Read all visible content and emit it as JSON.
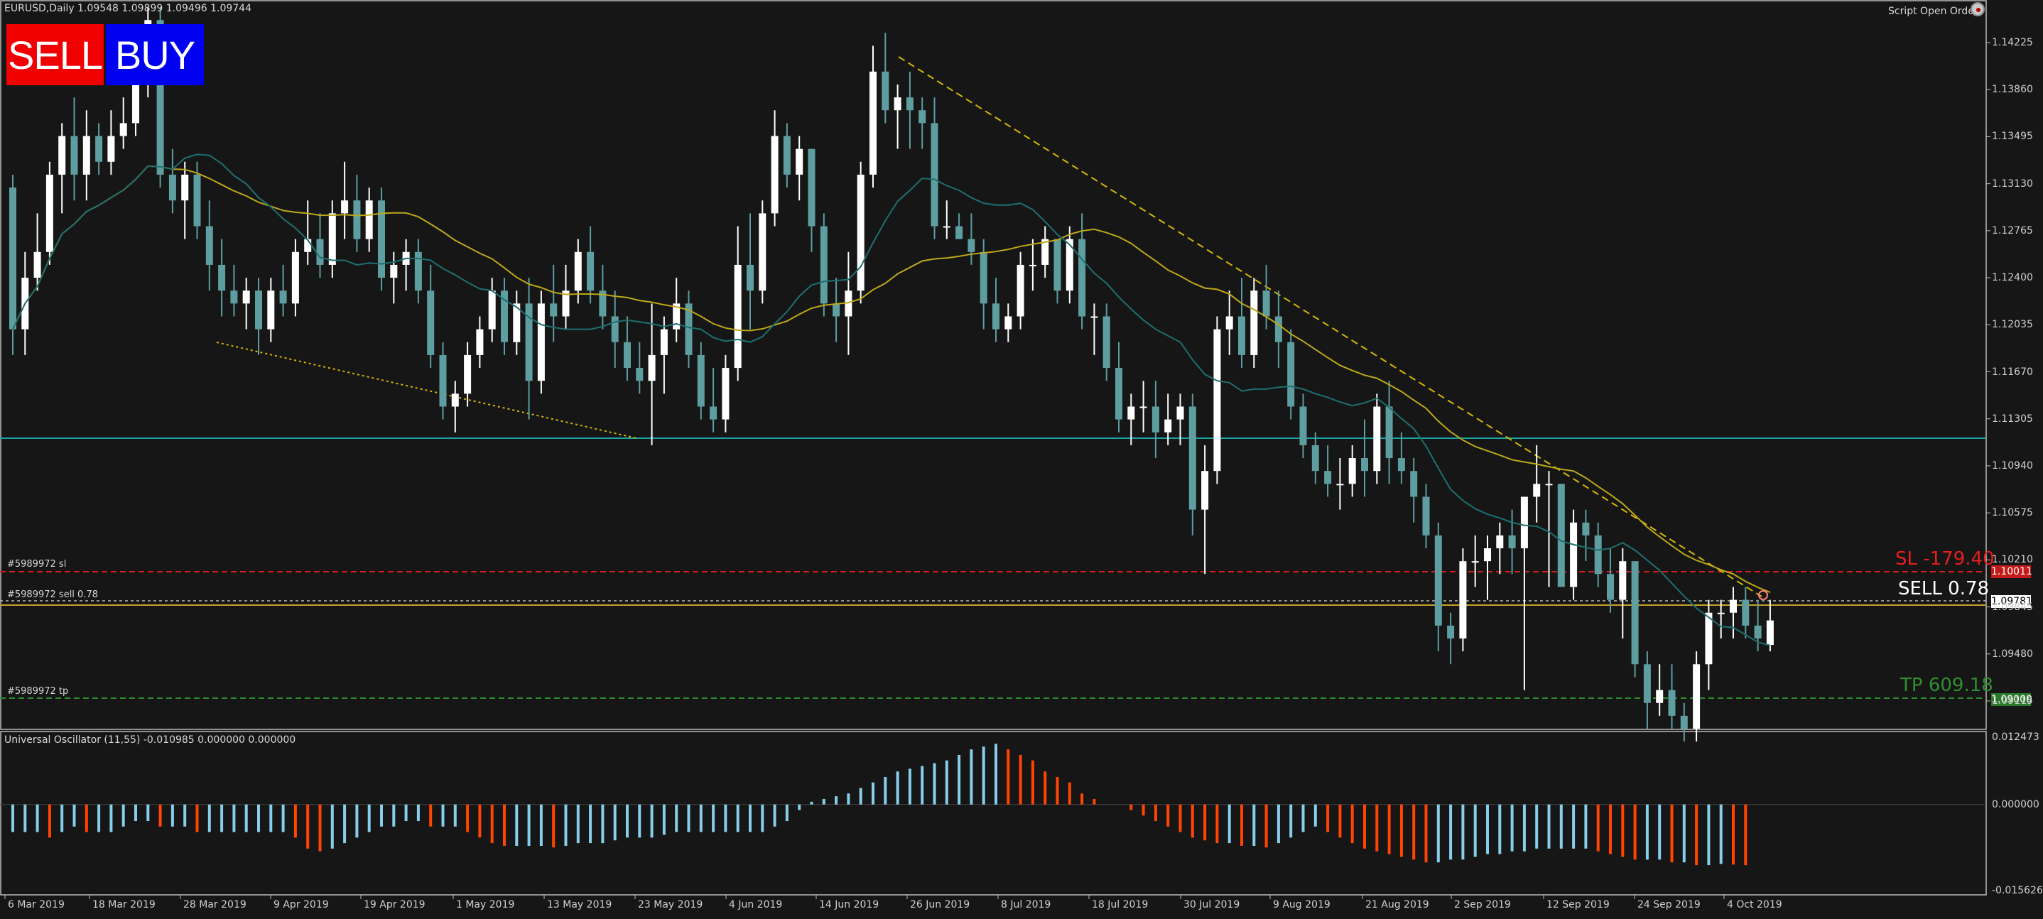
{
  "header": {
    "symbol_info": "EURUSD,Daily  1.09548 1.09899 1.09496 1.09744",
    "script_label": "Script Open Order"
  },
  "buttons": {
    "sell": "SELL",
    "buy": "BUY"
  },
  "trade_lines": {
    "sl_tag": "#5989972 sl",
    "sell_tag": "#5989972 sell 0.78",
    "tp_tag": "#5989972 tp",
    "sl_text": "SL  -179.40",
    "sell_text": "SELL  0.78",
    "tp_text": "TP  609.18",
    "sl_price": "1.10011",
    "sell_price": "1.09781",
    "tp_price": "1.09000"
  },
  "oscillator": {
    "label": "Universal Oscillator (11,55) -0.010985 0.000000 0.000000",
    "y_ticks": [
      "0.012473",
      "0.000000",
      "-0.015626"
    ]
  },
  "price_axis": [
    "1.14225",
    "1.13860",
    "1.13495",
    "1.13130",
    "1.12765",
    "1.12400",
    "1.12035",
    "1.11670",
    "1.11305",
    "1.10940",
    "1.10575",
    "1.10210",
    "1.09845",
    "1.09480",
    "1.09115"
  ],
  "time_axis": [
    "6 Mar 2019",
    "18 Mar 2019",
    "28 Mar 2019",
    "9 Apr 2019",
    "19 Apr 2019",
    "1 May 2019",
    "13 May 2019",
    "23 May 2019",
    "4 Jun 2019",
    "14 Jun 2019",
    "26 Jun 2019",
    "8 Jul 2019",
    "18 Jul 2019",
    "30 Jul 2019",
    "9 Aug 2019",
    "21 Aug 2019",
    "2 Sep 2019",
    "12 Sep 2019",
    "24 Sep 2019",
    "4 Oct 2019"
  ],
  "colors": {
    "background": "#161616",
    "bull_candle": "#ffffff",
    "bear_candle": "#5f9ea0",
    "sl_line": "#d11f1f",
    "tp_line": "#2d8c2d",
    "level_line": "#18a6a6",
    "osc_bull": "#87ceeb",
    "osc_bear": "#ff4500",
    "trend_line": "#d4b800"
  },
  "icons": {
    "script_icon": "script-running-icon"
  },
  "chart_data": {
    "type": "candlestick",
    "title": "EURUSD,Daily",
    "candles": [
      [
        1.131,
        1.132,
        1.118,
        1.12
      ],
      [
        1.12,
        1.126,
        1.118,
        1.124
      ],
      [
        1.124,
        1.129,
        1.123,
        1.126
      ],
      [
        1.126,
        1.133,
        1.125,
        1.132
      ],
      [
        1.132,
        1.136,
        1.129,
        1.135
      ],
      [
        1.135,
        1.138,
        1.13,
        1.132
      ],
      [
        1.132,
        1.137,
        1.13,
        1.135
      ],
      [
        1.135,
        1.136,
        1.132,
        1.133
      ],
      [
        1.133,
        1.137,
        1.132,
        1.135
      ],
      [
        1.135,
        1.138,
        1.134,
        1.136
      ],
      [
        1.136,
        1.141,
        1.135,
        1.14
      ],
      [
        1.14,
        1.145,
        1.138,
        1.144
      ],
      [
        1.144,
        1.145,
        1.131,
        1.132
      ],
      [
        1.132,
        1.134,
        1.129,
        1.13
      ],
      [
        1.13,
        1.133,
        1.127,
        1.132
      ],
      [
        1.132,
        1.133,
        1.127,
        1.128
      ],
      [
        1.128,
        1.13,
        1.123,
        1.125
      ],
      [
        1.125,
        1.127,
        1.121,
        1.123
      ],
      [
        1.123,
        1.125,
        1.121,
        1.122
      ],
      [
        1.122,
        1.124,
        1.12,
        1.123
      ],
      [
        1.123,
        1.124,
        1.118,
        1.12
      ],
      [
        1.12,
        1.124,
        1.119,
        1.123
      ],
      [
        1.123,
        1.125,
        1.121,
        1.122
      ],
      [
        1.122,
        1.127,
        1.121,
        1.126
      ],
      [
        1.126,
        1.13,
        1.125,
        1.127
      ],
      [
        1.127,
        1.129,
        1.124,
        1.125
      ],
      [
        1.125,
        1.13,
        1.124,
        1.129
      ],
      [
        1.129,
        1.133,
        1.127,
        1.13
      ],
      [
        1.13,
        1.132,
        1.126,
        1.127
      ],
      [
        1.127,
        1.131,
        1.126,
        1.13
      ],
      [
        1.13,
        1.131,
        1.123,
        1.124
      ],
      [
        1.124,
        1.126,
        1.122,
        1.125
      ],
      [
        1.125,
        1.127,
        1.123,
        1.126
      ],
      [
        1.126,
        1.127,
        1.122,
        1.123
      ],
      [
        1.123,
        1.125,
        1.117,
        1.118
      ],
      [
        1.118,
        1.119,
        1.113,
        1.114
      ],
      [
        1.114,
        1.116,
        1.112,
        1.115
      ],
      [
        1.115,
        1.119,
        1.114,
        1.118
      ],
      [
        1.118,
        1.121,
        1.117,
        1.12
      ],
      [
        1.12,
        1.124,
        1.119,
        1.123
      ],
      [
        1.123,
        1.124,
        1.118,
        1.119
      ],
      [
        1.119,
        1.123,
        1.118,
        1.122
      ],
      [
        1.122,
        1.124,
        1.113,
        1.116
      ],
      [
        1.116,
        1.123,
        1.115,
        1.122
      ],
      [
        1.122,
        1.125,
        1.119,
        1.121
      ],
      [
        1.121,
        1.125,
        1.12,
        1.123
      ],
      [
        1.123,
        1.127,
        1.122,
        1.126
      ],
      [
        1.126,
        1.128,
        1.122,
        1.123
      ],
      [
        1.123,
        1.125,
        1.12,
        1.121
      ],
      [
        1.121,
        1.123,
        1.117,
        1.119
      ],
      [
        1.119,
        1.121,
        1.116,
        1.117
      ],
      [
        1.117,
        1.119,
        1.115,
        1.116
      ],
      [
        1.116,
        1.122,
        1.111,
        1.118
      ],
      [
        1.118,
        1.121,
        1.115,
        1.12
      ],
      [
        1.12,
        1.124,
        1.119,
        1.122
      ],
      [
        1.122,
        1.123,
        1.117,
        1.118
      ],
      [
        1.118,
        1.119,
        1.113,
        1.114
      ],
      [
        1.114,
        1.117,
        1.112,
        1.113
      ],
      [
        1.113,
        1.118,
        1.112,
        1.117
      ],
      [
        1.117,
        1.128,
        1.116,
        1.125
      ],
      [
        1.125,
        1.129,
        1.12,
        1.123
      ],
      [
        1.123,
        1.13,
        1.122,
        1.129
      ],
      [
        1.129,
        1.137,
        1.128,
        1.135
      ],
      [
        1.135,
        1.136,
        1.131,
        1.132
      ],
      [
        1.132,
        1.135,
        1.13,
        1.134
      ],
      [
        1.134,
        1.134,
        1.126,
        1.128
      ],
      [
        1.128,
        1.129,
        1.121,
        1.122
      ],
      [
        1.122,
        1.124,
        1.119,
        1.121
      ],
      [
        1.121,
        1.126,
        1.118,
        1.123
      ],
      [
        1.123,
        1.133,
        1.122,
        1.132
      ],
      [
        1.132,
        1.142,
        1.131,
        1.14
      ],
      [
        1.14,
        1.143,
        1.136,
        1.137
      ],
      [
        1.137,
        1.139,
        1.134,
        1.138
      ],
      [
        1.138,
        1.14,
        1.134,
        1.137
      ],
      [
        1.137,
        1.138,
        1.134,
        1.136
      ],
      [
        1.136,
        1.138,
        1.127,
        1.128
      ],
      [
        1.128,
        1.13,
        1.127,
        1.128
      ],
      [
        1.128,
        1.129,
        1.127,
        1.127
      ],
      [
        1.127,
        1.129,
        1.125,
        1.126
      ],
      [
        1.126,
        1.127,
        1.12,
        1.122
      ],
      [
        1.122,
        1.124,
        1.119,
        1.12
      ],
      [
        1.12,
        1.122,
        1.119,
        1.121
      ],
      [
        1.121,
        1.126,
        1.12,
        1.125
      ],
      [
        1.125,
        1.127,
        1.123,
        1.125
      ],
      [
        1.125,
        1.128,
        1.124,
        1.127
      ],
      [
        1.127,
        1.127,
        1.122,
        1.123
      ],
      [
        1.123,
        1.128,
        1.122,
        1.127
      ],
      [
        1.127,
        1.129,
        1.12,
        1.121
      ],
      [
        1.121,
        1.122,
        1.118,
        1.121
      ],
      [
        1.121,
        1.122,
        1.116,
        1.117
      ],
      [
        1.117,
        1.119,
        1.112,
        1.113
      ],
      [
        1.113,
        1.115,
        1.111,
        1.114
      ],
      [
        1.114,
        1.116,
        1.112,
        1.114
      ],
      [
        1.114,
        1.116,
        1.11,
        1.112
      ],
      [
        1.112,
        1.115,
        1.111,
        1.113
      ],
      [
        1.113,
        1.115,
        1.111,
        1.114
      ],
      [
        1.114,
        1.115,
        1.104,
        1.106
      ],
      [
        1.106,
        1.111,
        1.101,
        1.109
      ],
      [
        1.109,
        1.121,
        1.108,
        1.12
      ],
      [
        1.12,
        1.123,
        1.118,
        1.121
      ],
      [
        1.121,
        1.124,
        1.117,
        1.118
      ],
      [
        1.118,
        1.124,
        1.117,
        1.123
      ],
      [
        1.123,
        1.125,
        1.12,
        1.121
      ],
      [
        1.121,
        1.123,
        1.117,
        1.119
      ],
      [
        1.119,
        1.12,
        1.113,
        1.114
      ],
      [
        1.114,
        1.115,
        1.11,
        1.111
      ],
      [
        1.111,
        1.112,
        1.108,
        1.109
      ],
      [
        1.109,
        1.111,
        1.107,
        1.108
      ],
      [
        1.108,
        1.11,
        1.106,
        1.108
      ],
      [
        1.108,
        1.111,
        1.107,
        1.11
      ],
      [
        1.11,
        1.113,
        1.107,
        1.109
      ],
      [
        1.109,
        1.115,
        1.108,
        1.114
      ],
      [
        1.114,
        1.116,
        1.108,
        1.11
      ],
      [
        1.11,
        1.112,
        1.108,
        1.109
      ],
      [
        1.109,
        1.11,
        1.105,
        1.107
      ],
      [
        1.107,
        1.108,
        1.103,
        1.104
      ],
      [
        1.104,
        1.105,
        1.095,
        1.097
      ],
      [
        1.097,
        1.098,
        1.094,
        1.096
      ],
      [
        1.096,
        1.103,
        1.095,
        1.102
      ],
      [
        1.102,
        1.104,
        1.1,
        1.102
      ],
      [
        1.102,
        1.104,
        1.099,
        1.103
      ],
      [
        1.103,
        1.105,
        1.101,
        1.104
      ],
      [
        1.104,
        1.106,
        1.101,
        1.103
      ],
      [
        1.103,
        1.106,
        1.092,
        1.107
      ],
      [
        1.107,
        1.111,
        1.105,
        1.108
      ],
      [
        1.108,
        1.109,
        1.1,
        1.108
      ],
      [
        1.108,
        1.108,
        1.1,
        1.1
      ],
      [
        1.1,
        1.106,
        1.099,
        1.105
      ],
      [
        1.105,
        1.106,
        1.102,
        1.104
      ],
      [
        1.104,
        1.105,
        1.1,
        1.101
      ],
      [
        1.101,
        1.103,
        1.098,
        1.099
      ],
      [
        1.099,
        1.103,
        1.096,
        1.102
      ],
      [
        1.102,
        1.102,
        1.093,
        1.094
      ],
      [
        1.094,
        1.095,
        1.089,
        1.091
      ],
      [
        1.091,
        1.094,
        1.09,
        1.092
      ],
      [
        1.092,
        1.094,
        1.089,
        1.09
      ],
      [
        1.09,
        1.091,
        1.088,
        1.089
      ],
      [
        1.089,
        1.095,
        1.088,
        1.094
      ],
      [
        1.094,
        1.099,
        1.092,
        1.098
      ],
      [
        1.098,
        1.099,
        1.096,
        1.098
      ],
      [
        1.098,
        1.1,
        1.096,
        1.099
      ],
      [
        1.099,
        1.1,
        1.096,
        1.097
      ],
      [
        1.097,
        1.099,
        1.095,
        1.096
      ],
      [
        1.0955,
        1.099,
        1.095,
        1.0974
      ]
    ],
    "oscillator": [
      -0.005,
      -0.005,
      -0.005,
      -0.006,
      -0.005,
      -0.004,
      -0.005,
      -0.005,
      -0.005,
      -0.004,
      -0.003,
      -0.003,
      -0.004,
      -0.004,
      -0.004,
      -0.005,
      -0.005,
      -0.005,
      -0.005,
      -0.005,
      -0.005,
      -0.005,
      -0.005,
      -0.006,
      -0.008,
      -0.0085,
      -0.008,
      -0.007,
      -0.006,
      -0.005,
      -0.004,
      -0.004,
      -0.003,
      -0.003,
      -0.004,
      -0.004,
      -0.004,
      -0.005,
      -0.006,
      -0.007,
      -0.0075,
      -0.0075,
      -0.0075,
      -0.0075,
      -0.0078,
      -0.0075,
      -0.007,
      -0.007,
      -0.007,
      -0.0065,
      -0.006,
      -0.006,
      -0.006,
      -0.0055,
      -0.005,
      -0.005,
      -0.005,
      -0.005,
      -0.005,
      -0.005,
      -0.005,
      -0.005,
      -0.004,
      -0.003,
      -0.001,
      0.0005,
      0.001,
      0.0015,
      0.002,
      0.003,
      0.004,
      0.005,
      0.006,
      0.0065,
      0.007,
      0.0075,
      0.008,
      0.009,
      0.01,
      0.0105,
      0.011,
      0.01,
      0.009,
      0.008,
      0.006,
      0.005,
      0.004,
      0.002,
      0.001,
      0.0,
      0.0,
      -0.001,
      -0.002,
      -0.003,
      -0.004,
      -0.005,
      -0.006,
      -0.0065,
      -0.007,
      -0.007,
      -0.0075,
      -0.0075,
      -0.0078,
      -0.007,
      -0.006,
      -0.005,
      -0.004,
      -0.005,
      -0.006,
      -0.007,
      -0.008,
      -0.0085,
      -0.009,
      -0.0095,
      -0.01,
      -0.0105,
      -0.0105,
      -0.01,
      -0.01,
      -0.0095,
      -0.009,
      -0.009,
      -0.0085,
      -0.0085,
      -0.008,
      -0.008,
      -0.008,
      -0.008,
      -0.008,
      -0.0085,
      -0.009,
      -0.0095,
      -0.01,
      -0.01,
      -0.01,
      -0.0105,
      -0.0105,
      -0.011,
      -0.011,
      -0.0108,
      -0.0109,
      -0.011
    ]
  }
}
